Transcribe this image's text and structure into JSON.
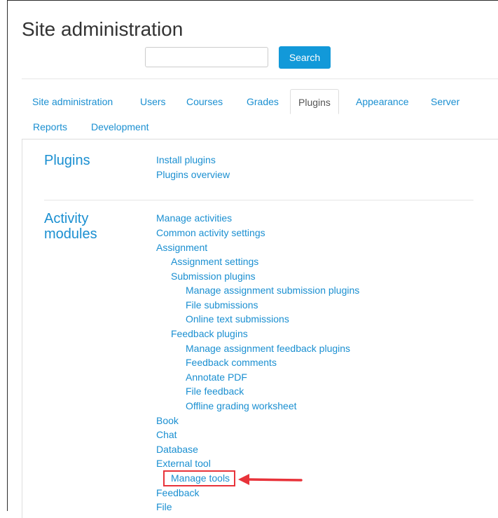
{
  "page": {
    "title": "Site administration"
  },
  "search": {
    "placeholder": "",
    "button_label": "Search"
  },
  "tabs": [
    {
      "label": "Site administration",
      "active": false
    },
    {
      "label": "Users",
      "active": false
    },
    {
      "label": "Courses",
      "active": false
    },
    {
      "label": "Grades",
      "active": false
    },
    {
      "label": "Plugins",
      "active": true
    },
    {
      "label": "Appearance",
      "active": false
    },
    {
      "label": "Server",
      "active": false
    },
    {
      "label": "Reports",
      "active": false
    },
    {
      "label": "Development",
      "active": false
    }
  ],
  "sections": {
    "plugins": {
      "title": "Plugins",
      "links": [
        "Install plugins",
        "Plugins overview"
      ]
    },
    "activity_modules": {
      "title_line1": "Activity",
      "title_line2": "modules",
      "links": [
        "Manage activities",
        "Common activity settings",
        "Assignment",
        "Assignment settings",
        "Submission plugins",
        "Manage assignment submission plugins",
        "File submissions",
        "Online text submissions",
        "Feedback plugins",
        "Manage assignment feedback plugins",
        "Feedback comments",
        "Annotate PDF",
        "File feedback",
        "Offline grading worksheet",
        "Book",
        "Chat",
        "Database",
        "External tool",
        "Manage tools",
        "Feedback",
        "File"
      ]
    }
  },
  "annotation": {
    "highlight_color": "#e8333a",
    "highlighted_item": "Manage tools"
  }
}
